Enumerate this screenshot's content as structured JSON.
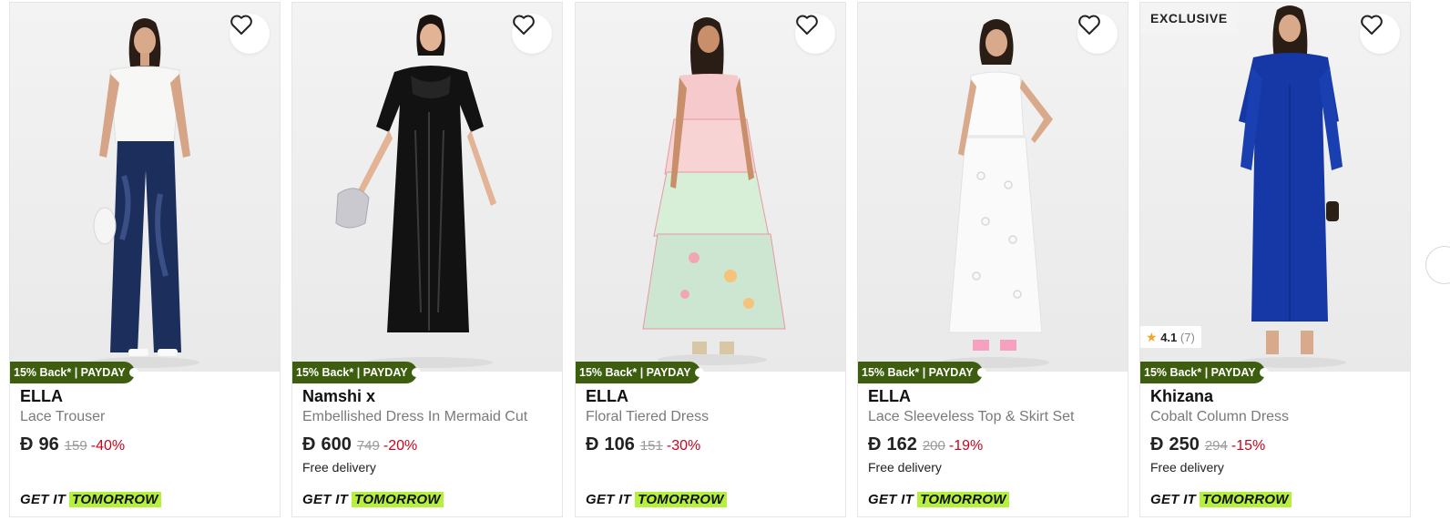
{
  "products": [
    {
      "brand": "ELLA",
      "name": "Lace Trouser",
      "currency_symbol": "Ð",
      "price": "96",
      "old_price": "159",
      "discount": "-40%",
      "free_delivery": "",
      "promo": "15% Back* | PAYDAY",
      "delivery_prefix": "GET IT",
      "delivery_day": "TOMORROW",
      "image": {
        "top": "#f4f4f4",
        "bottom": "#1c2e5c",
        "style": "trouser"
      }
    },
    {
      "brand": "Namshi x",
      "name": "Embellished Dress In Mermaid Cut",
      "currency_symbol": "Ð",
      "price": "600",
      "old_price": "749",
      "discount": "-20%",
      "free_delivery": "Free delivery",
      "promo": "15% Back* | PAYDAY",
      "delivery_prefix": "GET IT",
      "delivery_day": "TOMORROW",
      "image": {
        "top": "#111111",
        "bottom": "#151515",
        "style": "gown"
      }
    },
    {
      "brand": "ELLA",
      "name": "Floral Tiered Dress",
      "currency_symbol": "Ð",
      "price": "106",
      "old_price": "151",
      "discount": "-30%",
      "free_delivery": "",
      "promo": "15% Back* | PAYDAY",
      "delivery_prefix": "GET IT",
      "delivery_day": "TOMORROW",
      "image": {
        "top": "#f5c7c9",
        "bottom": "#cfe6cf",
        "style": "tiered"
      }
    },
    {
      "brand": "ELLA",
      "name": "Lace Sleeveless Top & Skirt Set",
      "currency_symbol": "Ð",
      "price": "162",
      "old_price": "200",
      "discount": "-19%",
      "free_delivery": "Free delivery",
      "promo": "15% Back* | PAYDAY",
      "delivery_prefix": "GET IT",
      "delivery_day": "TOMORROW",
      "image": {
        "top": "#fafafa",
        "bottom": "#f2f2f2",
        "style": "white-set"
      }
    },
    {
      "brand": "Khizana",
      "name": "Cobalt Column Dress",
      "currency_symbol": "Ð",
      "price": "250",
      "old_price": "294",
      "discount": "-15%",
      "free_delivery": "Free delivery",
      "promo": "15% Back* | PAYDAY",
      "delivery_prefix": "GET IT",
      "delivery_day": "TOMORROW",
      "badge": "EXCLUSIVE",
      "rating": {
        "value": "4.1",
        "count": "(7)"
      },
      "image": {
        "top": "#1a3fb0",
        "bottom": "#1638a6",
        "style": "column"
      }
    }
  ],
  "colors": {
    "promo_bg": "#3e5e0f",
    "discount": "#d0021b",
    "tomorrow_highlight": "#b7f03c",
    "star": "#f5a623"
  }
}
